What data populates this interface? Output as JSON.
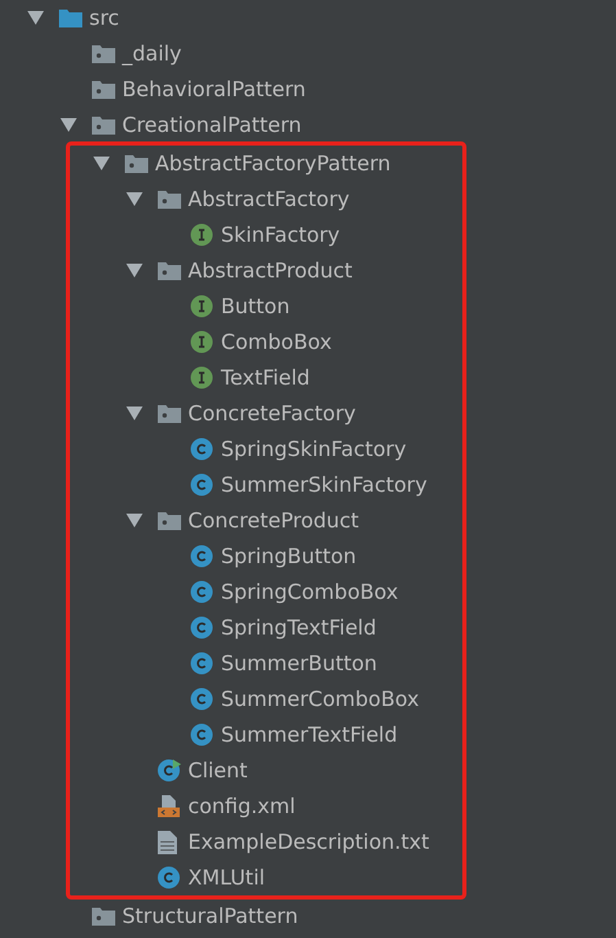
{
  "tree": [
    {
      "label": "src",
      "kind": "source-folder",
      "expanded": true,
      "children": [
        {
          "label": "_daily",
          "kind": "folder"
        },
        {
          "label": "BehavioralPattern",
          "kind": "folder"
        },
        {
          "label": "CreationalPattern",
          "kind": "folder",
          "expanded": true,
          "children": [
            {
              "label": "AbstractFactoryPattern",
              "kind": "folder",
              "expanded": true,
              "highlighted": true,
              "children": [
                {
                  "label": "AbstractFactory",
                  "kind": "folder",
                  "expanded": true,
                  "children": [
                    {
                      "label": "SkinFactory",
                      "kind": "interface"
                    }
                  ]
                },
                {
                  "label": "AbstractProduct",
                  "kind": "folder",
                  "expanded": true,
                  "children": [
                    {
                      "label": "Button",
                      "kind": "interface"
                    },
                    {
                      "label": "ComboBox",
                      "kind": "interface"
                    },
                    {
                      "label": "TextField",
                      "kind": "interface"
                    }
                  ]
                },
                {
                  "label": "ConcreteFactory",
                  "kind": "folder",
                  "expanded": true,
                  "children": [
                    {
                      "label": "SpringSkinFactory",
                      "kind": "class"
                    },
                    {
                      "label": "SummerSkinFactory",
                      "kind": "class"
                    }
                  ]
                },
                {
                  "label": "ConcreteProduct",
                  "kind": "folder",
                  "expanded": true,
                  "children": [
                    {
                      "label": "SpringButton",
                      "kind": "class"
                    },
                    {
                      "label": "SpringComboBox",
                      "kind": "class"
                    },
                    {
                      "label": "SpringTextField",
                      "kind": "class"
                    },
                    {
                      "label": "SummerButton",
                      "kind": "class"
                    },
                    {
                      "label": "SummerComboBox",
                      "kind": "class"
                    },
                    {
                      "label": "SummerTextField",
                      "kind": "class"
                    }
                  ]
                },
                {
                  "label": "Client",
                  "kind": "main-class"
                },
                {
                  "label": "config.xml",
                  "kind": "xml"
                },
                {
                  "label": "ExampleDescription.txt",
                  "kind": "text"
                },
                {
                  "label": "XMLUtil",
                  "kind": "class"
                }
              ]
            }
          ]
        },
        {
          "label": "StructuralPattern",
          "kind": "folder"
        }
      ]
    }
  ]
}
